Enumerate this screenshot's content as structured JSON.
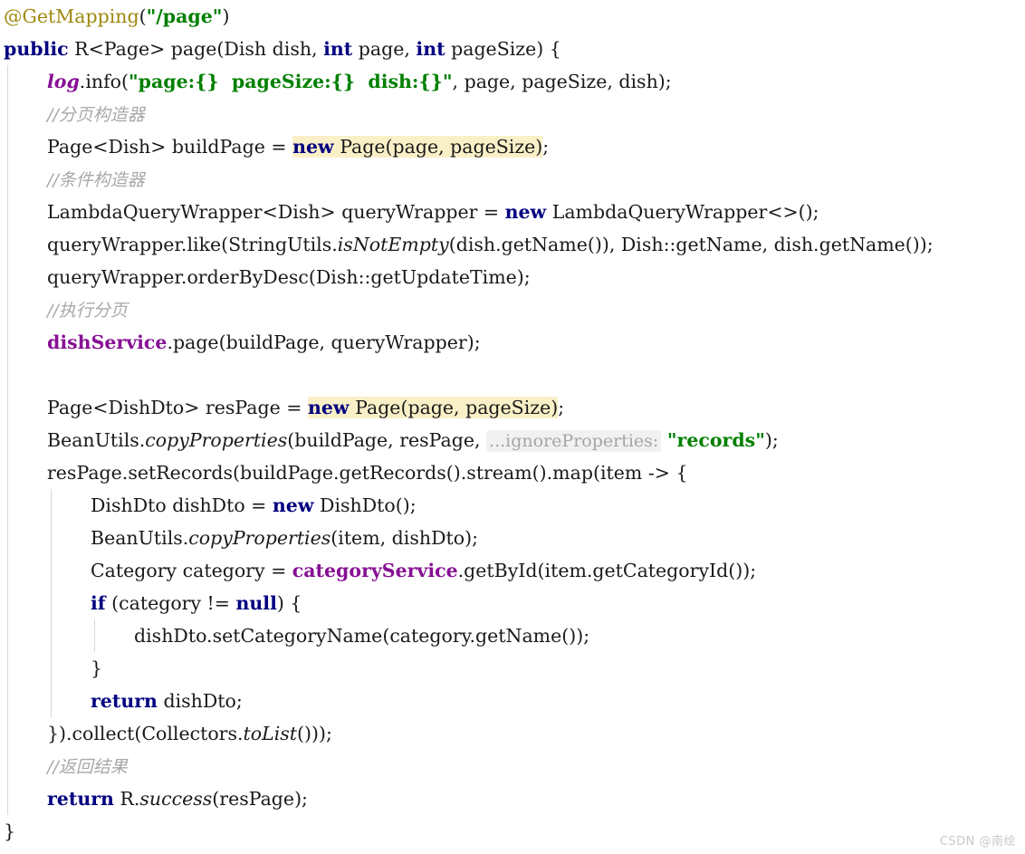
{
  "editor": {
    "language": "Java",
    "font_size_px": 20,
    "theme": "IntelliJ Light",
    "colors": {
      "background": "#ffffff",
      "foreground": "#1a1a1a",
      "keyword": "#000080",
      "string": "#008000",
      "comment": "#a8a8a8",
      "annotation": "#9e880d",
      "field": "#871094",
      "search_highlight": "#faf0c8",
      "inlay_hint_bg": "#f1f1f1",
      "inlay_hint_fg": "#a5a5a5",
      "indent_guide": "#d8d8d8"
    },
    "search_highlight_term": "new Page(page, pageSize)",
    "inlay_hint": "...ignoreProperties:"
  },
  "watermark": {
    "text": "CSDN @南绘"
  },
  "code_lines": [
    {
      "n": 1,
      "indent": 0,
      "text": "@GetMapping(\"/page\")",
      "tokens": [
        {
          "t": "@GetMapping",
          "c": "anno"
        },
        {
          "t": "(",
          "c": "plain"
        },
        {
          "t": "\"/page\"",
          "c": "str"
        },
        {
          "t": ")",
          "c": "plain"
        }
      ]
    },
    {
      "n": 2,
      "indent": 0,
      "text": "public R<Page> page(Dish dish, int page, int pageSize) {",
      "tokens": [
        {
          "t": "public",
          "c": "kw"
        },
        {
          "t": " R<Page> page(Dish dish, ",
          "c": "plain"
        },
        {
          "t": "int",
          "c": "kw"
        },
        {
          "t": " page, ",
          "c": "plain"
        },
        {
          "t": "int",
          "c": "kw"
        },
        {
          "t": " pageSize) {",
          "c": "plain"
        }
      ]
    },
    {
      "n": 3,
      "indent": 1,
      "text": "log.info(\"page:{}  pageSize:{}  dish:{}\", page, pageSize, dish);",
      "tokens": [
        {
          "t": "log",
          "c": "sfield"
        },
        {
          "t": ".info(",
          "c": "plain"
        },
        {
          "t": "\"page:{}  pageSize:{}  dish:{}\"",
          "c": "str"
        },
        {
          "t": ", page, pageSize, dish);",
          "c": "plain"
        }
      ]
    },
    {
      "n": 4,
      "indent": 1,
      "text": "//分页构造器",
      "tokens": [
        {
          "t": "//分页构造器",
          "c": "cmt"
        }
      ]
    },
    {
      "n": 5,
      "indent": 1,
      "text": "Page<Dish> buildPage = new Page(page, pageSize);",
      "tokens": [
        {
          "t": "Page<Dish> buildPage = ",
          "c": "plain"
        },
        {
          "t": "new",
          "c": "kw-hl"
        },
        {
          "t": " Page(page, pageSize)",
          "c": "plain-hl"
        },
        {
          "t": ";",
          "c": "plain"
        }
      ]
    },
    {
      "n": 6,
      "indent": 1,
      "text": "//条件构造器",
      "tokens": [
        {
          "t": "//条件构造器",
          "c": "cmt"
        }
      ]
    },
    {
      "n": 7,
      "indent": 1,
      "text": "LambdaQueryWrapper<Dish> queryWrapper = new LambdaQueryWrapper<>();",
      "tokens": [
        {
          "t": "LambdaQueryWrapper<Dish> queryWrapper = ",
          "c": "plain"
        },
        {
          "t": "new",
          "c": "kw"
        },
        {
          "t": " LambdaQueryWrapper<>();",
          "c": "plain"
        }
      ]
    },
    {
      "n": 8,
      "indent": 1,
      "text": "queryWrapper.like(StringUtils.isNotEmpty(dish.getName()), Dish::getName, dish.getName());",
      "tokens": [
        {
          "t": "queryWrapper.like(StringUtils.",
          "c": "plain"
        },
        {
          "t": "isNotEmpty",
          "c": "smeth"
        },
        {
          "t": "(dish.getName()), Dish::getName, dish.getName());",
          "c": "plain"
        }
      ]
    },
    {
      "n": 9,
      "indent": 1,
      "text": "queryWrapper.orderByDesc(Dish::getUpdateTime);",
      "tokens": [
        {
          "t": "queryWrapper.orderByDesc(Dish::getUpdateTime);",
          "c": "plain"
        }
      ]
    },
    {
      "n": 10,
      "indent": 1,
      "text": "//执行分页",
      "tokens": [
        {
          "t": "//执行分页",
          "c": "cmt"
        }
      ]
    },
    {
      "n": 11,
      "indent": 1,
      "text": "dishService.page(buildPage, queryWrapper);",
      "tokens": [
        {
          "t": "dishService",
          "c": "field"
        },
        {
          "t": ".page(buildPage, queryWrapper);",
          "c": "plain"
        }
      ]
    },
    {
      "n": 12,
      "indent": 1,
      "text": "",
      "tokens": []
    },
    {
      "n": 13,
      "indent": 1,
      "text": "Page<DishDto> resPage = new Page(page, pageSize);",
      "tokens": [
        {
          "t": "Page<DishDto> resPage = ",
          "c": "plain"
        },
        {
          "t": "new",
          "c": "kw-hl"
        },
        {
          "t": " Page(page, pageSize)",
          "c": "plain-hl"
        },
        {
          "t": ";",
          "c": "plain"
        }
      ]
    },
    {
      "n": 14,
      "indent": 1,
      "text": "BeanUtils.copyProperties(buildPage, resPage, ...ignoreProperties: \"records\");",
      "tokens": [
        {
          "t": "BeanUtils.",
          "c": "plain"
        },
        {
          "t": "copyProperties",
          "c": "smeth"
        },
        {
          "t": "(buildPage, resPage, ",
          "c": "plain"
        },
        {
          "t": "...ignoreProperties:",
          "c": "hint"
        },
        {
          "t": " ",
          "c": "plain"
        },
        {
          "t": "\"records\"",
          "c": "str"
        },
        {
          "t": ");",
          "c": "plain"
        }
      ]
    },
    {
      "n": 15,
      "indent": 1,
      "text": "resPage.setRecords(buildPage.getRecords().stream().map(item -> {",
      "tokens": [
        {
          "t": "resPage.setRecords(buildPage.getRecords().stream().map(item -> {",
          "c": "plain"
        }
      ]
    },
    {
      "n": 16,
      "indent": 2,
      "text": "DishDto dishDto = new DishDto();",
      "tokens": [
        {
          "t": "DishDto dishDto = ",
          "c": "plain"
        },
        {
          "t": "new",
          "c": "kw"
        },
        {
          "t": " DishDto();",
          "c": "plain"
        }
      ]
    },
    {
      "n": 17,
      "indent": 2,
      "text": "BeanUtils.copyProperties(item, dishDto);",
      "tokens": [
        {
          "t": "BeanUtils.",
          "c": "plain"
        },
        {
          "t": "copyProperties",
          "c": "smeth"
        },
        {
          "t": "(item, dishDto);",
          "c": "plain"
        }
      ]
    },
    {
      "n": 18,
      "indent": 2,
      "text": "Category category = categoryService.getById(item.getCategoryId());",
      "tokens": [
        {
          "t": "Category category = ",
          "c": "plain"
        },
        {
          "t": "categoryService",
          "c": "field"
        },
        {
          "t": ".getById(item.getCategoryId());",
          "c": "plain"
        }
      ]
    },
    {
      "n": 19,
      "indent": 2,
      "text": "if (category != null) {",
      "tokens": [
        {
          "t": "if",
          "c": "kw"
        },
        {
          "t": " (category != ",
          "c": "plain"
        },
        {
          "t": "null",
          "c": "kw"
        },
        {
          "t": ") {",
          "c": "plain"
        }
      ]
    },
    {
      "n": 20,
      "indent": 3,
      "text": "dishDto.setCategoryName(category.getName());",
      "tokens": [
        {
          "t": "dishDto.setCategoryName(category.getName());",
          "c": "plain"
        }
      ]
    },
    {
      "n": 21,
      "indent": 2,
      "text": "}",
      "tokens": [
        {
          "t": "}",
          "c": "plain"
        }
      ]
    },
    {
      "n": 22,
      "indent": 2,
      "text": "return dishDto;",
      "tokens": [
        {
          "t": "return",
          "c": "kw"
        },
        {
          "t": " dishDto;",
          "c": "plain"
        }
      ]
    },
    {
      "n": 23,
      "indent": 1,
      "text": "}).collect(Collectors.toList()));",
      "tokens": [
        {
          "t": "}).collect(Collectors.",
          "c": "plain"
        },
        {
          "t": "toList",
          "c": "smeth"
        },
        {
          "t": "()));",
          "c": "plain"
        }
      ]
    },
    {
      "n": 24,
      "indent": 1,
      "text": "//返回结果",
      "tokens": [
        {
          "t": "//返回结果",
          "c": "cmt"
        }
      ]
    },
    {
      "n": 25,
      "indent": 1,
      "text": "return R.success(resPage);",
      "tokens": [
        {
          "t": "return",
          "c": "kw"
        },
        {
          "t": " R.",
          "c": "plain"
        },
        {
          "t": "success",
          "c": "smeth"
        },
        {
          "t": "(resPage);",
          "c": "plain"
        }
      ]
    },
    {
      "n": 26,
      "indent": 0,
      "text": "}",
      "tokens": [
        {
          "t": "}",
          "c": "plain"
        }
      ]
    }
  ]
}
